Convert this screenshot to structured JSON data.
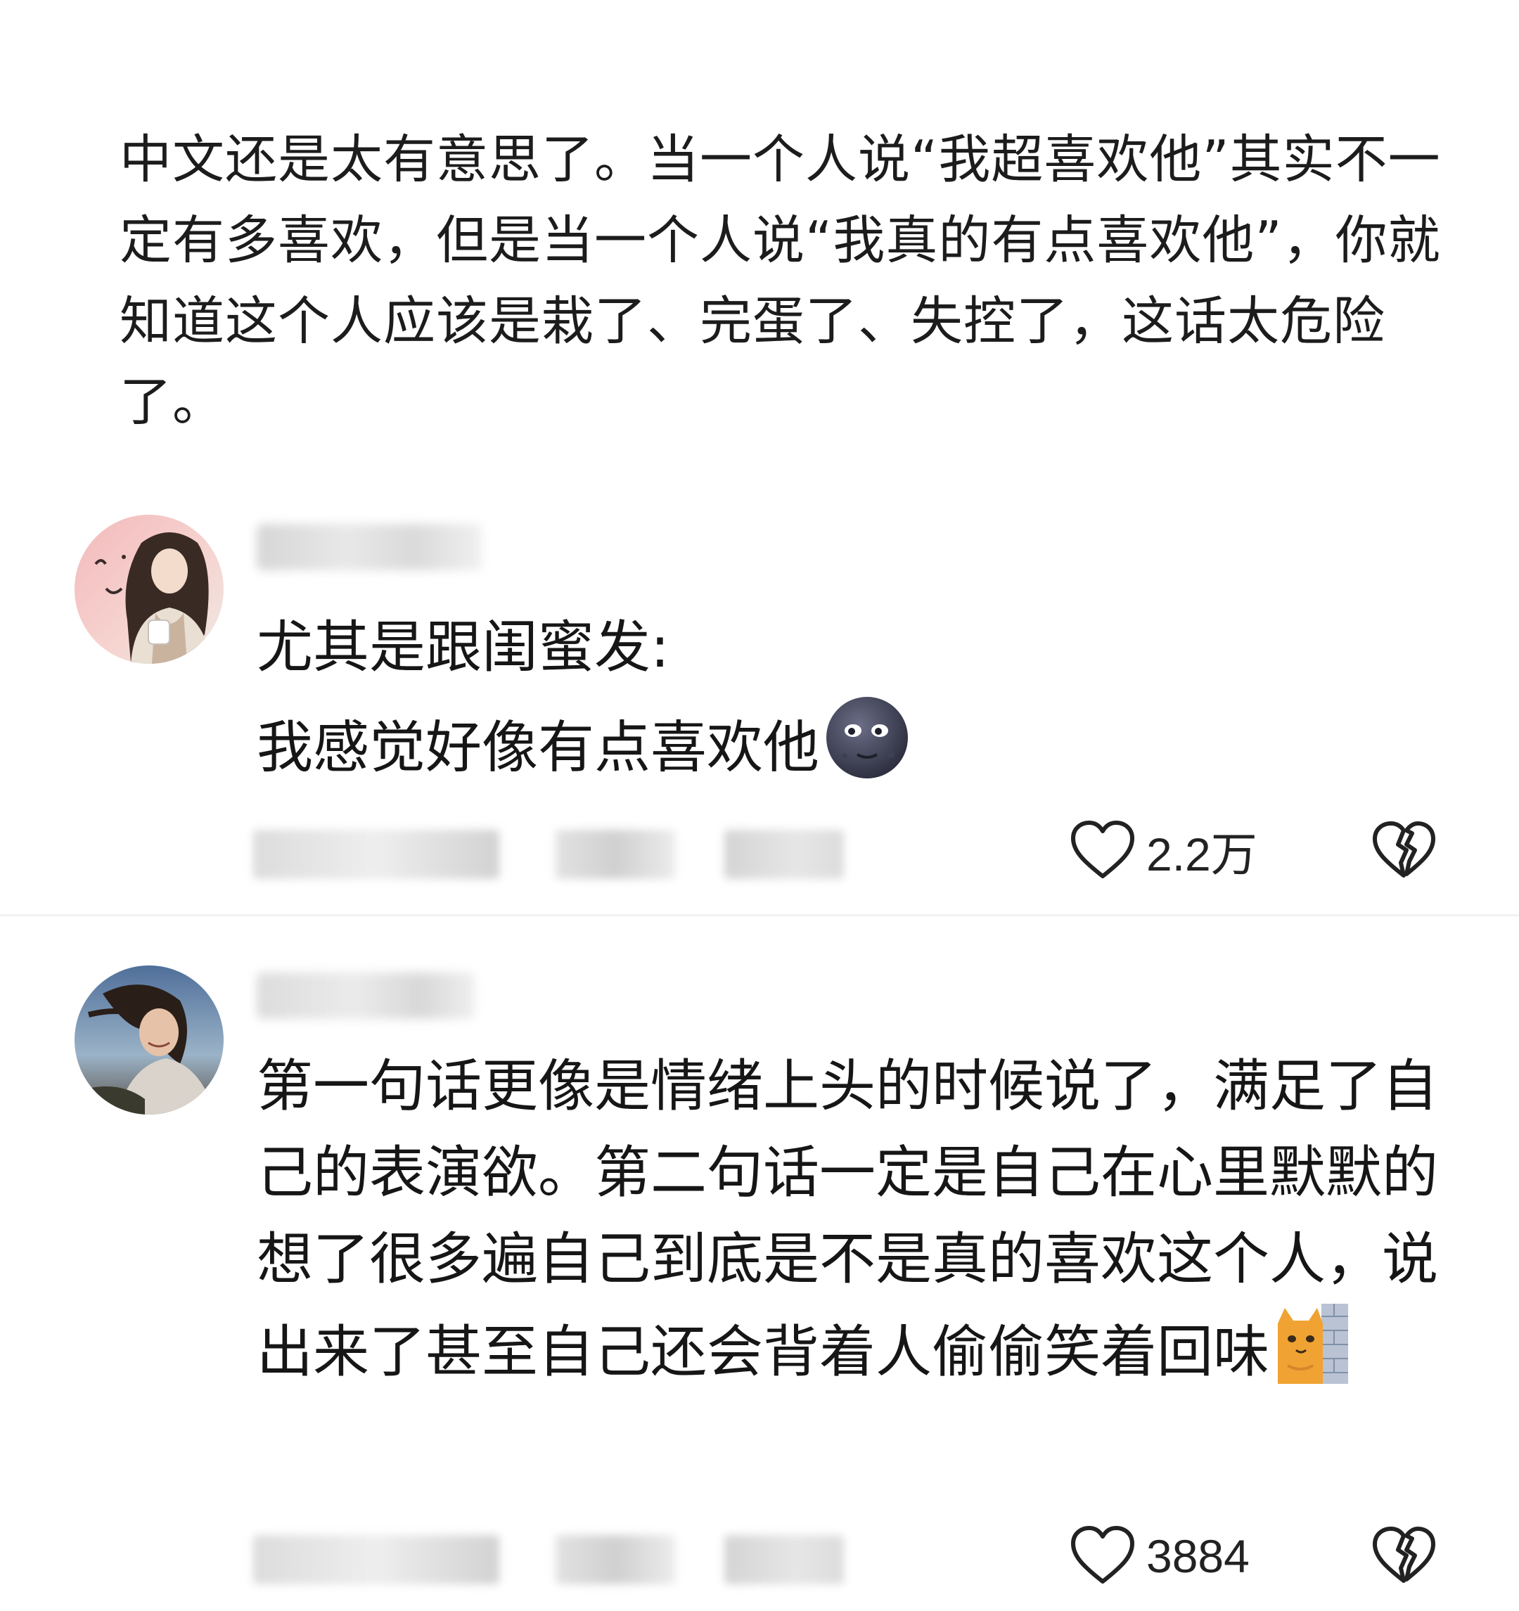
{
  "post": {
    "text": "中文还是太有意思了。当一个人说“我超喜欢他”其实不一定有多喜欢，但是当一个人说“我真的有点喜欢他”，你就知道这个人应该是栽了、完蛋了、失控了，这话太危险了。"
  },
  "comments": [
    {
      "line1": "尤其是跟闺蜜发:",
      "line2": "我感觉好像有点喜欢他",
      "emoji": "new-moon-face",
      "likes": "2.2万",
      "avatar": "woman-photo-avatar"
    },
    {
      "text": "第一句话更像是情绪上头的时候说了，满足了自己的表演欲。第二句话一定是自己在心里默默的想了很多遍自己到底是不是真的喜欢这个人，说出来了甚至自己还会背着人偷偷笑着回味",
      "emoji": "cat-behind-wall",
      "likes": "3884",
      "avatar": "woman-photo-avatar"
    }
  ],
  "icons": {
    "like": "heart-outline-icon",
    "dislike": "broken-heart-icon"
  },
  "colors": {
    "text": "#1c1c1c",
    "muted_blur": "#d9d9d9",
    "background": "#ffffff"
  }
}
